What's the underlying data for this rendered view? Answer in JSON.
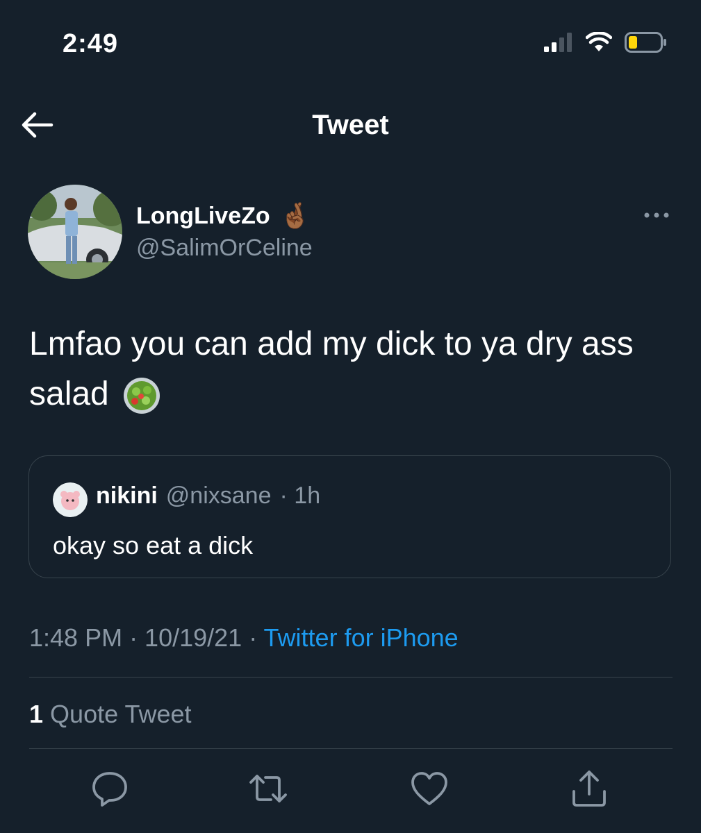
{
  "status_bar": {
    "time": "2:49"
  },
  "nav": {
    "back_icon": "arrow-left-icon",
    "title": "Tweet"
  },
  "tweet": {
    "author": {
      "display_name": "LongLiveZo",
      "name_emoji": "🤞🏾",
      "handle": "@SalimOrCeline"
    },
    "text": "Lmfao you can add my dick to ya dry ass salad",
    "text_emoji": "🥗",
    "quoted": {
      "name": "nikini",
      "handle": "@nixsane",
      "age": "· 1h",
      "text": "okay so eat a dick"
    },
    "timestamp": "1:48 PM · 10/19/21 ·",
    "source": "Twitter for iPhone",
    "quote_count": "1",
    "quote_label": "Quote Tweet"
  },
  "actions": [
    "reply-icon",
    "retweet-icon",
    "like-icon",
    "share-icon"
  ],
  "colors": {
    "background": "#15202b",
    "secondary_text": "#8b98a5",
    "link": "#1d9bf0",
    "divider": "#38444d"
  }
}
